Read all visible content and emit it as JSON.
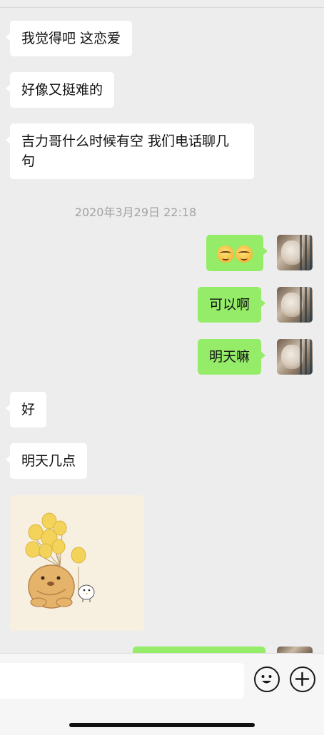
{
  "messages": {
    "in_1": "我觉得吧 这恋爱",
    "in_2": "好像又挺难的",
    "in_3": "吉力哥什么时候有空 我们电话聊几句",
    "timestamp": "2020年3月29日 22:18",
    "out_1_emoji": "emoji-face-x2",
    "out_2": "可以啊",
    "out_3": "明天嘛",
    "in_4": "好",
    "in_5": "明天几点"
  },
  "sticker": {
    "icon": "bear-with-balloons-sticker"
  },
  "input": {
    "value": "",
    "placeholder": ""
  },
  "icons": {
    "emoji": "emoji-icon",
    "plus": "plus-icon"
  },
  "colors": {
    "background": "#ededed",
    "incoming_bubble": "#ffffff",
    "outgoing_bubble": "#95ec69",
    "timestamp": "#a3a3a3"
  }
}
